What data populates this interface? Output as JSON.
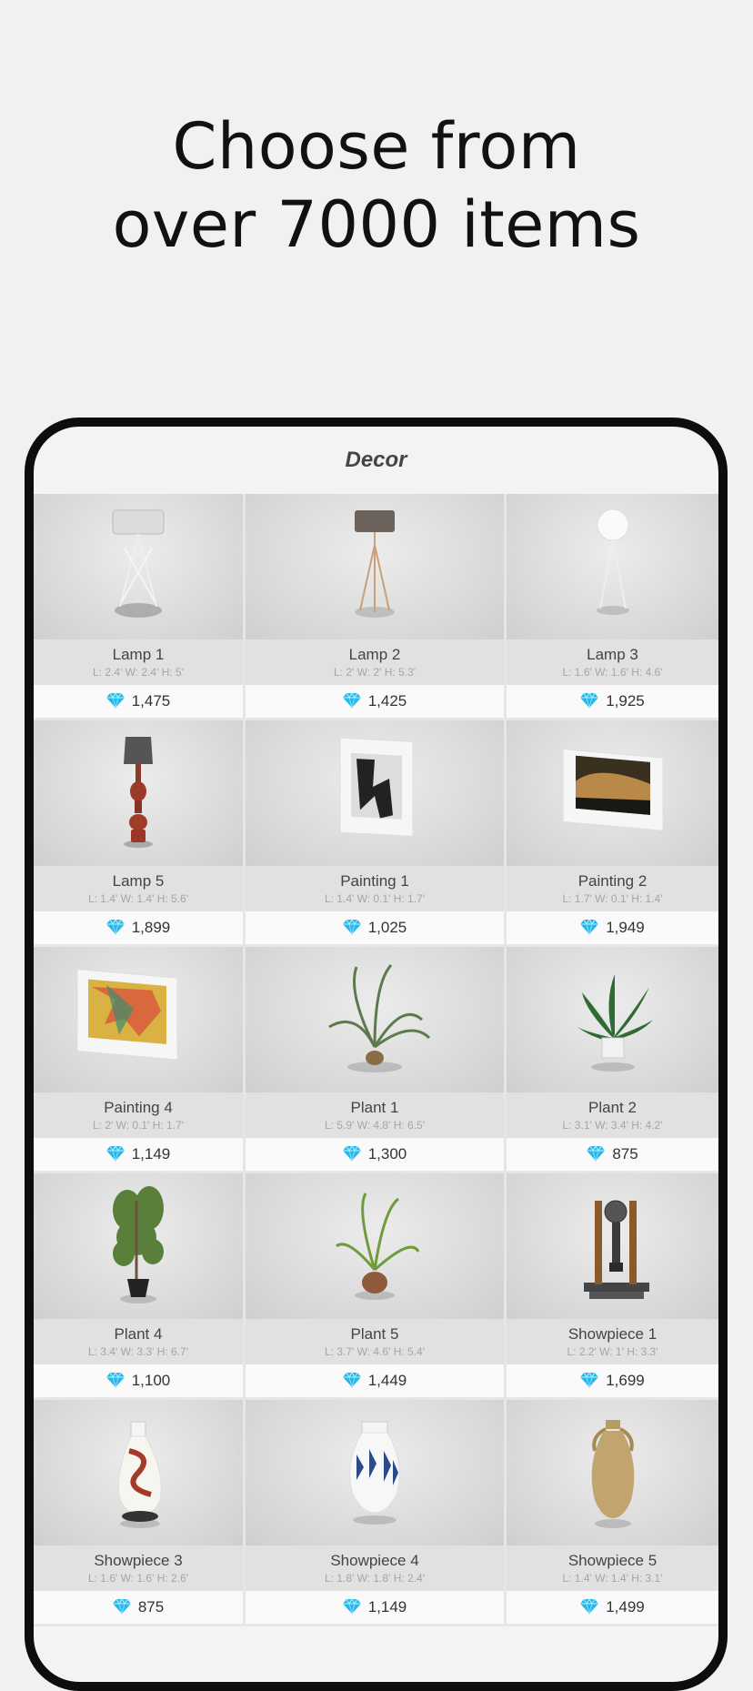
{
  "headline": {
    "line1": "Choose from",
    "line2": "over 7000 items"
  },
  "screen": {
    "title": "Decor"
  },
  "colors": {
    "gem": "#27b8ea",
    "accent_dark": "#0d0d0d"
  },
  "currency_icon": "diamond-icon",
  "items": [
    {
      "name": "Lamp 1",
      "dims": "L: 2.4' W: 2.4' H: 5'",
      "price": "1,475",
      "image": "lamp-1"
    },
    {
      "name": "Lamp 2",
      "dims": "L: 2' W: 2' H: 5.3'",
      "price": "1,425",
      "image": "lamp-2"
    },
    {
      "name": "Lamp 3",
      "dims": "L: 1.6' W: 1.6' H: 4.6'",
      "price": "1,925",
      "image": "lamp-3"
    },
    {
      "name": "Lamp 5",
      "dims": "L: 1.4' W: 1.4' H: 5.6'",
      "price": "1,899",
      "image": "lamp-5"
    },
    {
      "name": "Painting 1",
      "dims": "L: 1.4' W: 0.1' H: 1.7'",
      "price": "1,025",
      "image": "painting-1"
    },
    {
      "name": "Painting 2",
      "dims": "L: 1.7' W: 0.1' H: 1.4'",
      "price": "1,949",
      "image": "painting-2"
    },
    {
      "name": "Painting 4",
      "dims": "L: 2' W: 0.1' H: 1.7'",
      "price": "1,149",
      "image": "painting-4"
    },
    {
      "name": "Plant 1",
      "dims": "L: 5.9' W: 4.8' H: 6.5'",
      "price": "1,300",
      "image": "plant-1"
    },
    {
      "name": "Plant 2",
      "dims": "L: 3.1' W: 3.4' H: 4.2'",
      "price": "875",
      "image": "plant-2"
    },
    {
      "name": "Plant 4",
      "dims": "L: 3.4' W: 3.3' H: 6.7'",
      "price": "1,100",
      "image": "plant-4"
    },
    {
      "name": "Plant 5",
      "dims": "L: 3.7' W: 4.6' H: 5.4'",
      "price": "1,449",
      "image": "plant-5"
    },
    {
      "name": "Showpiece 1",
      "dims": "L: 2.2' W: 1' H: 3.3'",
      "price": "1,699",
      "image": "showpiece-1"
    },
    {
      "name": "Showpiece 3",
      "dims": "L: 1.6' W: 1.6' H: 2.6'",
      "price": "875",
      "image": "showpiece-3"
    },
    {
      "name": "Showpiece 4",
      "dims": "L: 1.8' W: 1.8' H: 2.4'",
      "price": "1,149",
      "image": "showpiece-4"
    },
    {
      "name": "Showpiece 5",
      "dims": "L: 1.4' W: 1.4' H: 3.1'",
      "price": "1,499",
      "image": "showpiece-5"
    }
  ]
}
